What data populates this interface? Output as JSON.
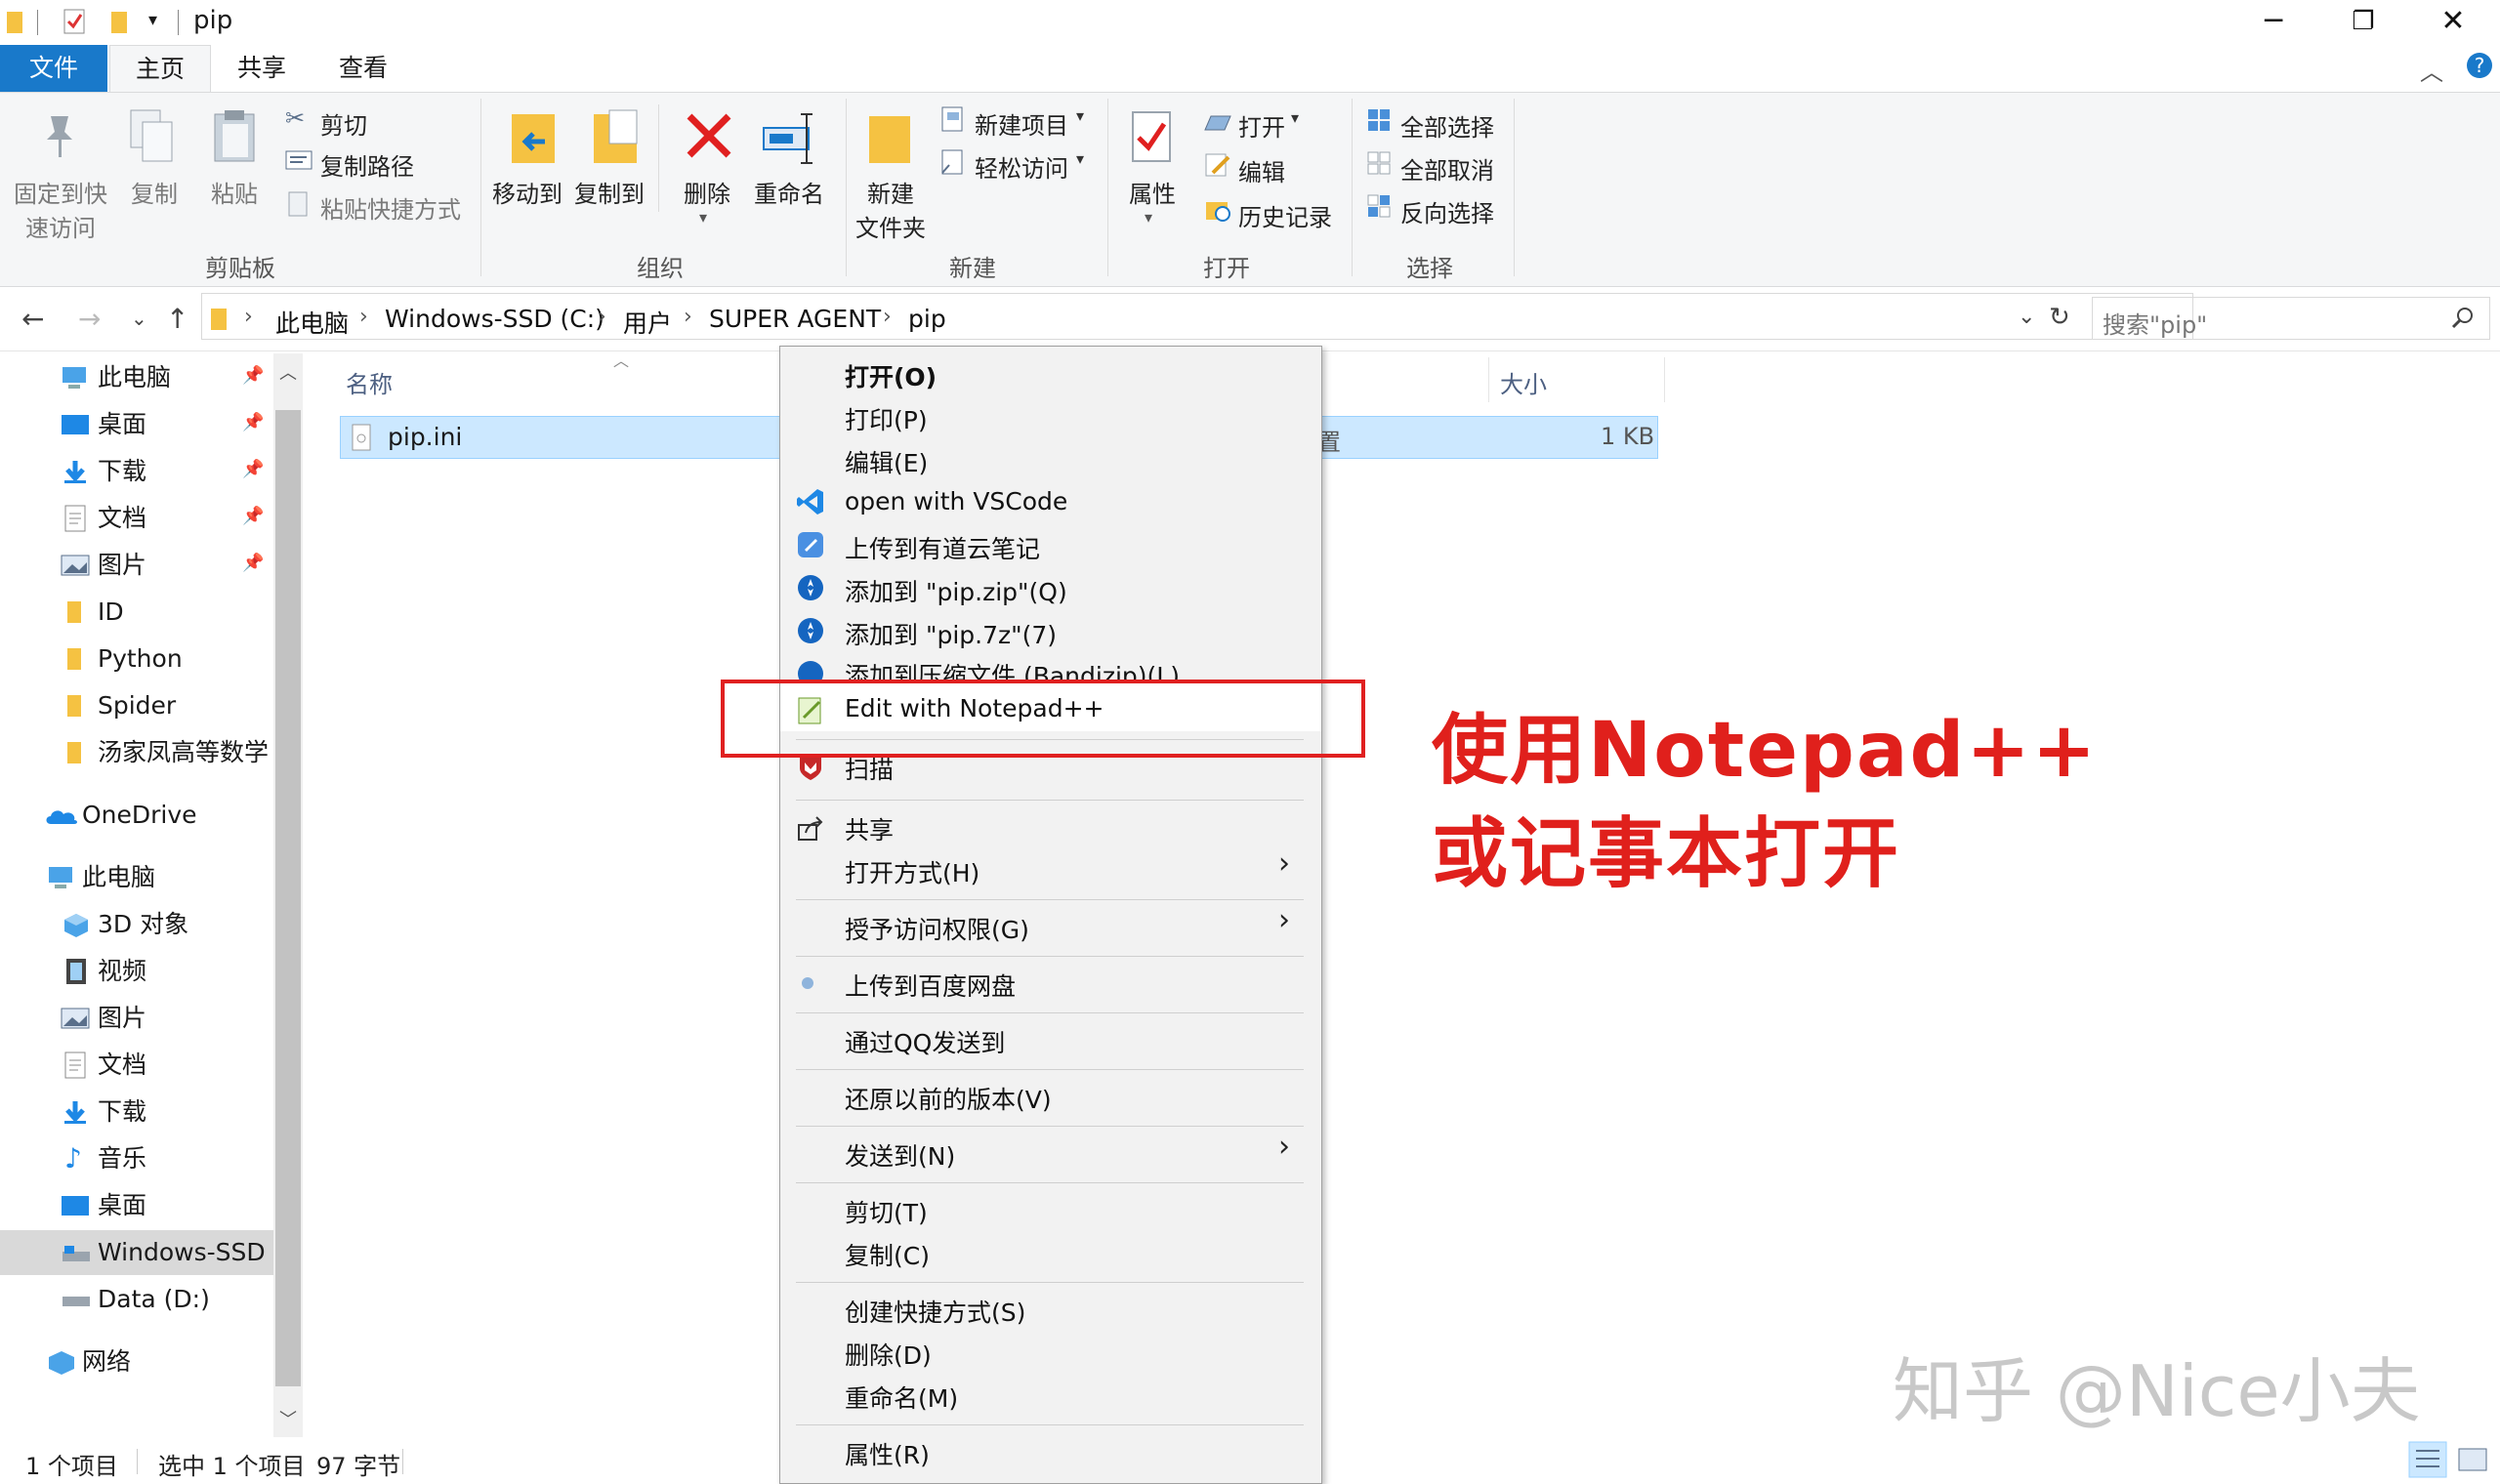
{
  "window": {
    "title": "pip",
    "buttons": {
      "minimize": "─",
      "restore": "❐",
      "close": "✕"
    }
  },
  "ribbon_tabs": {
    "file": "文件",
    "home": "主页",
    "share": "共享",
    "view": "查看"
  },
  "ribbon": {
    "clipboard": {
      "pin_line1": "固定到快",
      "pin_line2": "速访问",
      "copy": "复制",
      "paste": "粘贴",
      "cut": "剪切",
      "copy_path": "复制路径",
      "paste_shortcut": "粘贴快捷方式",
      "group": "剪贴板"
    },
    "organize": {
      "move_to": "移动到",
      "copy_to": "复制到",
      "delete": "删除",
      "rename": "重命名",
      "group": "组织"
    },
    "new": {
      "new_folder_line1": "新建",
      "new_folder_line2": "文件夹",
      "new_item": "新建项目",
      "easy_access": "轻松访问",
      "group": "新建"
    },
    "open": {
      "properties": "属性",
      "open": "打开",
      "edit": "编辑",
      "history": "历史记录",
      "group": "打开"
    },
    "select": {
      "select_all": "全部选择",
      "select_none": "全部取消",
      "invert": "反向选择",
      "group": "选择"
    }
  },
  "address": {
    "crumbs": [
      "此电脑",
      "Windows-SSD (C:)",
      "用户",
      "SUPER AGENT",
      "pip"
    ],
    "search_placeholder": "搜索\"pip\""
  },
  "nav": {
    "quick": [
      "此电脑",
      "桌面",
      "下载",
      "文档",
      "图片",
      "ID",
      "Python",
      "Spider",
      "汤家凤高等数学"
    ],
    "onedrive": "OneDrive",
    "thispc": "此电脑",
    "pc_items": [
      "3D 对象",
      "视频",
      "图片",
      "文档",
      "下载",
      "音乐",
      "桌面",
      "Windows-SSD (",
      "Data (D:)"
    ],
    "network": "网络"
  },
  "filelist": {
    "columns": {
      "name": "名称",
      "size": "大小"
    },
    "rows": [
      {
        "name": "pip.ini",
        "size": "1 KB",
        "type_tail": "置"
      }
    ]
  },
  "statusbar": {
    "count": "1 个项目",
    "selected": "选中 1 个项目",
    "bytes": "97 字节"
  },
  "context_menu": {
    "open": "打开(O)",
    "print": "打印(P)",
    "edit": "编辑(E)",
    "vscode": "open with VSCode",
    "youdao": "上传到有道云笔记",
    "zip": "添加到 \"pip.zip\"(Q)",
    "sevenz": "添加到 \"pip.7z\"(7)",
    "bandizip": "添加到压缩文件 (Bandizip)(L)...",
    "notepad": "Edit with Notepad++",
    "scan": "扫描",
    "share": "共享",
    "open_with": "打开方式(H)",
    "grant_access": "授予访问权限(G)",
    "baidu": "上传到百度网盘",
    "qq": "通过QQ发送到",
    "restore": "还原以前的版本(V)",
    "send_to": "发送到(N)",
    "cut": "剪切(T)",
    "copy": "复制(C)",
    "shortcut": "创建快捷方式(S)",
    "delete": "删除(D)",
    "rename": "重命名(M)",
    "properties": "属性(R)"
  },
  "annotation": {
    "line1": "使用Notepad++",
    "line2": "或记事本打开",
    "color": "#e0201c"
  },
  "watermark": "知乎 @Nice小夫"
}
